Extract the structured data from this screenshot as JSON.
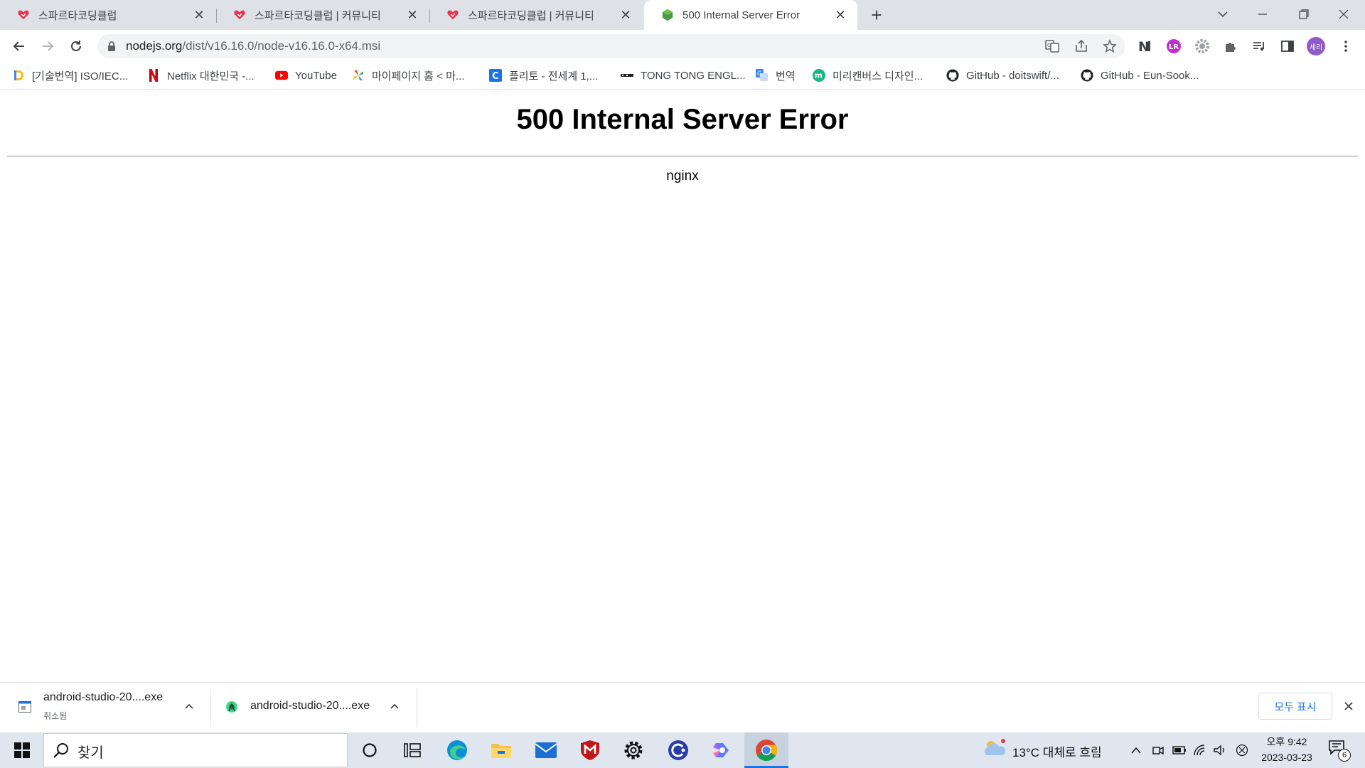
{
  "tabs": [
    {
      "title": "스파르타코딩클럽",
      "active": false
    },
    {
      "title": "스파르타코딩클럽 | 커뮤니티",
      "active": false
    },
    {
      "title": "스파르타코딩클럽 | 커뮤니티",
      "active": false
    },
    {
      "title": "500 Internal Server Error",
      "active": true
    }
  ],
  "address_bar": {
    "host": "nodejs.org",
    "path": "/dist/v16.16.0/node-v16.16.0-x64.msi"
  },
  "profile_avatar_text": "세리",
  "extension_badge_text": "LR",
  "bookmarks": [
    {
      "label": "[기술번역] ISO/IEC...",
      "icon": "d-logo-icon"
    },
    {
      "label": "Netflix 대한민국 -...",
      "icon": "netflix-icon"
    },
    {
      "label": "YouTube",
      "icon": "youtube-icon"
    },
    {
      "label": "마이페이지 홈 < 마...",
      "icon": "pinwheel-icon"
    },
    {
      "label": "플리토 - 전세계 1,...",
      "icon": "flitto-icon"
    },
    {
      "label": "TONG TONG ENGL...",
      "icon": "tongtong-icon"
    },
    {
      "label": "번역",
      "icon": "translate-icon"
    },
    {
      "label": "미리캔버스 디자인...",
      "icon": "miricanvas-icon"
    },
    {
      "label": "GitHub - doitswift/...",
      "icon": "github-icon"
    },
    {
      "label": "GitHub - Eun-Sook...",
      "icon": "github-icon"
    }
  ],
  "page": {
    "heading": "500 Internal Server Error",
    "server": "nginx"
  },
  "downloads": [
    {
      "name": "android-studio-20....exe",
      "status": "취소됨"
    },
    {
      "name": "android-studio-20....exe",
      "status": ""
    }
  ],
  "download_shelf": {
    "show_all": "모두 표시"
  },
  "taskbar": {
    "search_placeholder": "찾기",
    "weather": "13°C  대체로 흐림",
    "time": "오후 9:42",
    "date": "2023-03-23",
    "notification_count": "6"
  },
  "colors": {
    "tabstrip": "#dee1e6",
    "taskbar": "#dfe6ef",
    "link_blue": "#1a73e8",
    "profile_purple": "#8e5bc8"
  }
}
